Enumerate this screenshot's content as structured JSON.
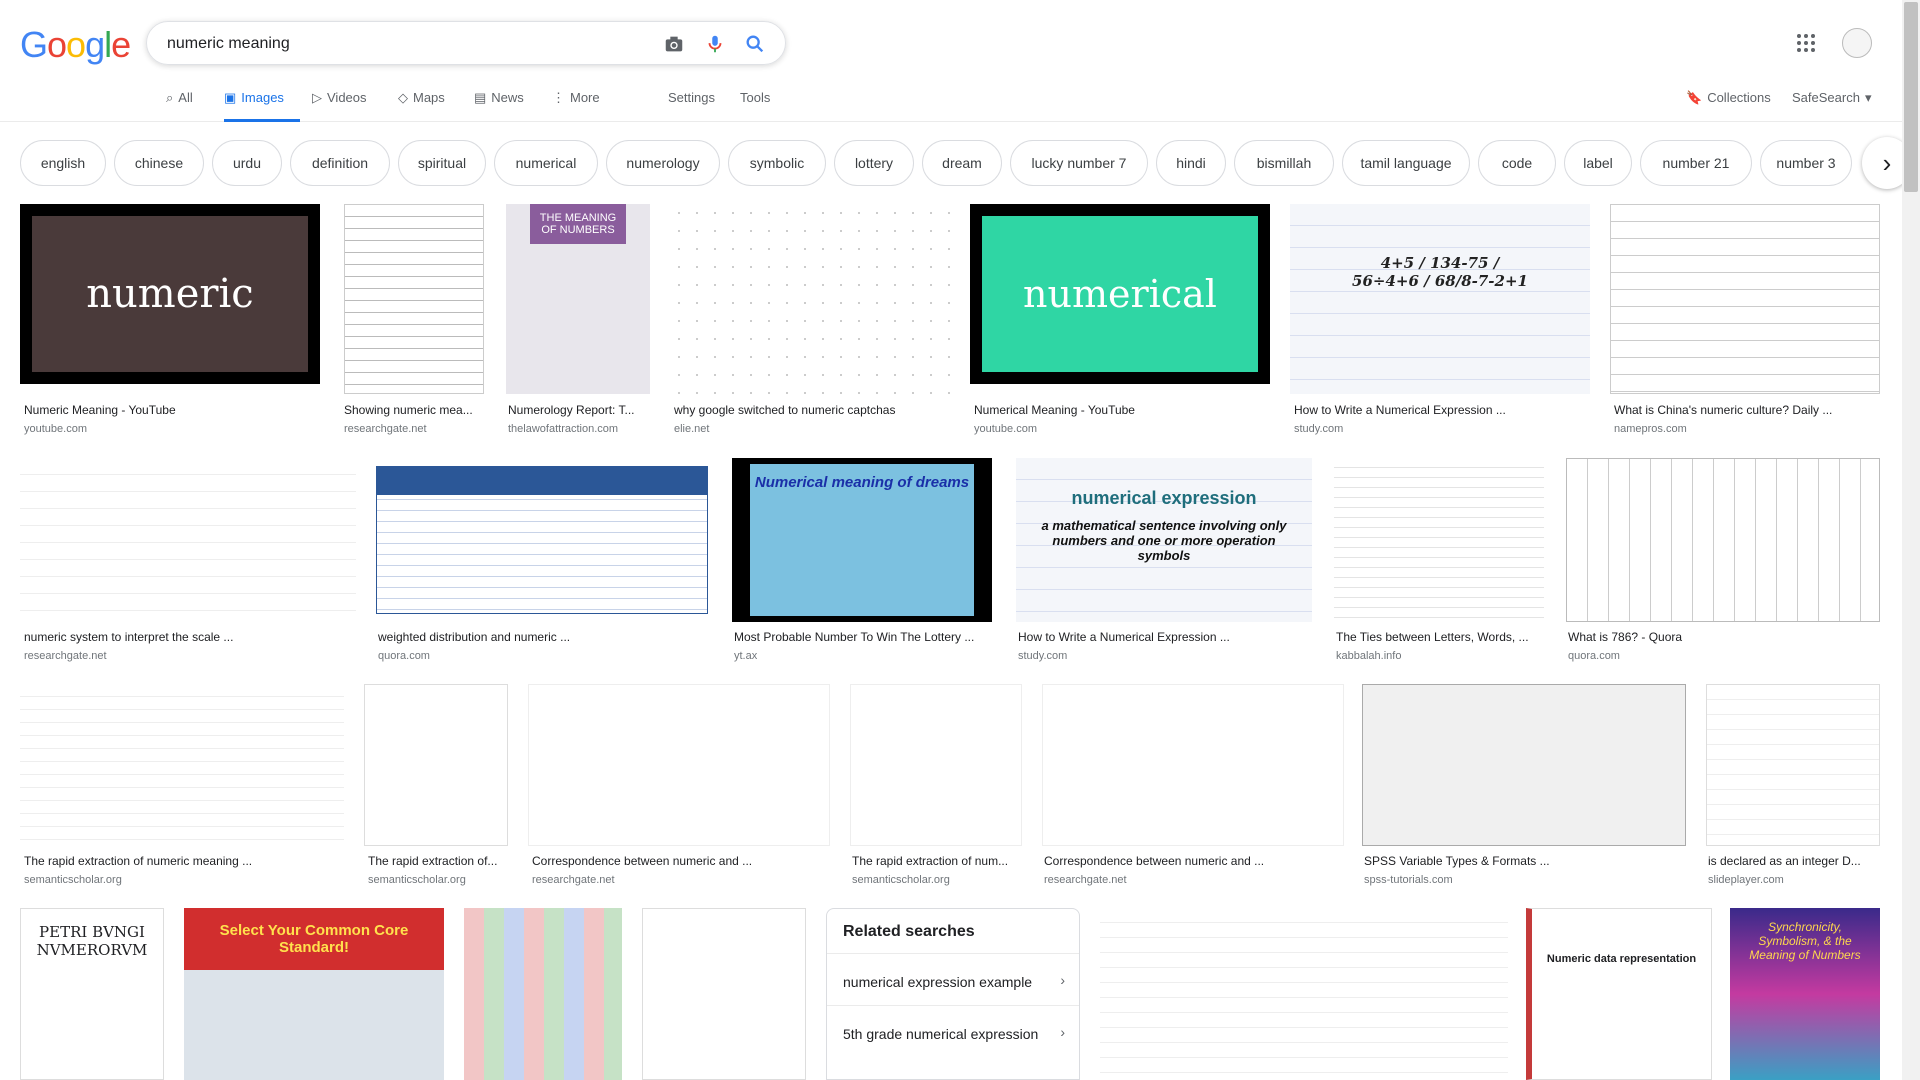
{
  "logo": "Google",
  "search": {
    "query": "numeric meaning"
  },
  "tabs": [
    {
      "label": "All"
    },
    {
      "label": "Images"
    },
    {
      "label": "Videos"
    },
    {
      "label": "Maps"
    },
    {
      "label": "News"
    },
    {
      "label": "More"
    }
  ],
  "settings": "Settings",
  "tools": "Tools",
  "collections": "Collections",
  "safesearch": "SafeSearch",
  "chips": [
    "english",
    "chinese",
    "urdu",
    "definition",
    "spiritual",
    "numerical",
    "numerology",
    "symbolic",
    "lottery",
    "dream",
    "lucky number 7",
    "hindi",
    "bismillah",
    "tamil language",
    "code",
    "label",
    "number 21",
    "number 3"
  ],
  "thumb_text": {
    "numeric": "numeric",
    "numerical": "numerical",
    "meaning_of_numbers": "THE MEANING OF NUMBERS",
    "expr": "4+5 / 134-75 / 56÷4+6 / 68/8-7-2+1",
    "dreams": "Numerical meaning of dreams",
    "numexpr": "numerical expression",
    "numexpr_sub": "a mathematical sentence involving only numbers and one or more operation symbols",
    "common_core": "Select Your Common Core Standard!",
    "petri": "PETRI BVNGI NVMERORVM",
    "numdata": "Numeric data representation",
    "synchronicity": "Synchronicity, Symbolism, & the Meaning of Numbers"
  },
  "results": [
    {
      "caption": "Numeric Meaning - YouTube",
      "source": "youtube.com"
    },
    {
      "caption": "Showing numeric mea...",
      "source": "researchgate.net"
    },
    {
      "caption": "Numerology Report: T...",
      "source": "thelawofattraction.com"
    },
    {
      "caption": "why google switched to numeric captchas",
      "source": "elie.net"
    },
    {
      "caption": "Numerical Meaning - YouTube",
      "source": "youtube.com"
    },
    {
      "caption": "How to Write a Numerical Expression ...",
      "source": "study.com"
    },
    {
      "caption": "What is China's numeric culture? Daily ...",
      "source": "namepros.com"
    },
    {
      "caption": "numeric system to interpret the scale ...",
      "source": "researchgate.net"
    },
    {
      "caption": "weighted distribution and numeric ...",
      "source": "quora.com"
    },
    {
      "caption": "Most Probable Number To Win The Lottery ...",
      "source": "yt.ax"
    },
    {
      "caption": "How to Write a Numerical Expression ...",
      "source": "study.com"
    },
    {
      "caption": "The Ties between Letters, Words, ...",
      "source": "kabbalah.info"
    },
    {
      "caption": "What is 786? - Quora",
      "source": "quora.com"
    },
    {
      "caption": "The rapid extraction of numeric meaning ...",
      "source": "semanticscholar.org"
    },
    {
      "caption": "The rapid extraction of...",
      "source": "semanticscholar.org"
    },
    {
      "caption": "Correspondence between numeric and ...",
      "source": "researchgate.net"
    },
    {
      "caption": "The rapid extraction of num...",
      "source": "semanticscholar.org"
    },
    {
      "caption": "Correspondence between numeric and ...",
      "source": "researchgate.net"
    },
    {
      "caption": "SPSS Variable Types & Formats ...",
      "source": "spss-tutorials.com"
    },
    {
      "caption": "is declared as an integer D...",
      "source": "slideplayer.com"
    }
  ],
  "related": {
    "title": "Related searches",
    "items": [
      "numerical expression example",
      "5th grade numerical expression"
    ]
  }
}
